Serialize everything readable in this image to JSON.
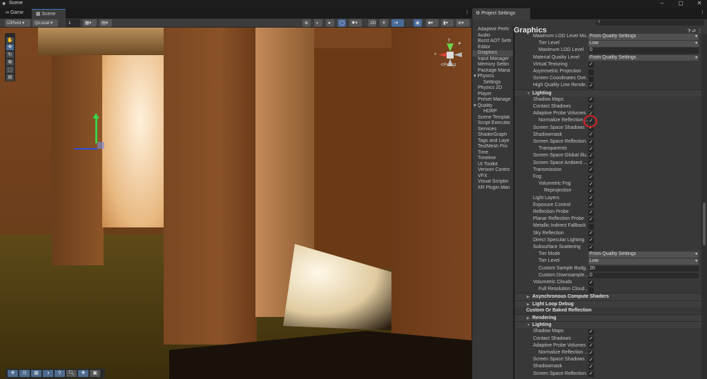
{
  "window": {
    "title": "Scene",
    "minimize": "–",
    "maximize": "▢",
    "close": "✕"
  },
  "tabs": [
    {
      "label": "Game",
      "icon": "gamepad-icon"
    },
    {
      "label": "Scene",
      "icon": "grid-icon"
    }
  ],
  "toolbar": {
    "pivot": "Pivot",
    "local": "Local",
    "grid_value": "1",
    "more": "⋮"
  },
  "scene": {
    "persp_label": "Persp",
    "gizmo_y": "y",
    "gizmo_x": "x"
  },
  "project_settings": {
    "tab_label": "Project Settings",
    "more": "⋮",
    "search_placeholder": "",
    "title": "Graphics",
    "nav": [
      "Adaptive Perfc",
      "Audio",
      "Burst AOT Setti",
      "Editor",
      "Graphics",
      "Input Manager",
      "Memory Settin",
      "Package Mana",
      "Physics",
      "Settings",
      "Physics 2D",
      "Player",
      "Preset Manage",
      "Quality",
      "HDRP",
      "Scene Templat",
      "Script Executio",
      "Services",
      "ShaderGraph",
      "Tags and Laye",
      "TextMesh Pro",
      "Time",
      "Timeline",
      "UI Toolkit",
      "Version Contro",
      "VFX",
      "Visual Scriptin",
      "XR Plugin Man"
    ],
    "selected_nav": "Graphics",
    "rows": [
      {
        "t": "dd",
        "l": "Maximum LOD Level Mo...",
        "v": "From Quality Settings",
        "i": 1
      },
      {
        "t": "dd",
        "l": "Tier Level",
        "v": "Low",
        "i": 2
      },
      {
        "t": "in",
        "l": "Maximum LOD Level",
        "v": "0",
        "i": 2
      },
      {
        "t": "dd",
        "l": "Material Quality Level",
        "v": "From Quality Settings",
        "i": 1
      },
      {
        "t": "cb",
        "l": "Virtual Texturing",
        "v": true,
        "i": 1
      },
      {
        "t": "cb",
        "l": "Asymmetric Projection",
        "v": false,
        "i": 1
      },
      {
        "t": "cb",
        "l": "Screen Coordinates Ove...",
        "v": false,
        "i": 1
      },
      {
        "t": "cb",
        "l": "High Quality Line Rende...",
        "v": true,
        "i": 1
      },
      {
        "t": "hdr",
        "l": "Lighting",
        "open": true
      },
      {
        "t": "cb",
        "l": "Shadow Maps",
        "v": true,
        "i": 1
      },
      {
        "t": "cb",
        "l": "Contact Shadows",
        "v": true,
        "i": 1
      },
      {
        "t": "cb",
        "l": "Adaptive Probe Volumes",
        "v": true,
        "i": 1
      },
      {
        "t": "cb",
        "l": "Normalize Reflection ...",
        "v": true,
        "i": 2
      },
      {
        "t": "cb",
        "l": "Screen Space Shadows",
        "v": true,
        "i": 1
      },
      {
        "t": "cb",
        "l": "Shadowmask",
        "v": true,
        "i": 1
      },
      {
        "t": "cb",
        "l": "Screen Space Reflection",
        "v": true,
        "i": 1
      },
      {
        "t": "cb",
        "l": "Transparents",
        "v": true,
        "i": 2
      },
      {
        "t": "cb",
        "l": "Screen Space Global Illu...",
        "v": true,
        "i": 1
      },
      {
        "t": "cb",
        "l": "Screen Space Ambient ...",
        "v": true,
        "i": 1
      },
      {
        "t": "cb",
        "l": "Transmission",
        "v": true,
        "i": 1
      },
      {
        "t": "cb",
        "l": "Fog",
        "v": true,
        "i": 1
      },
      {
        "t": "cb",
        "l": "Volumetric Fog",
        "v": true,
        "i": 2
      },
      {
        "t": "cb",
        "l": "Reprojection",
        "v": true,
        "i": 3
      },
      {
        "t": "cb",
        "l": "Light Layers",
        "v": true,
        "i": 1
      },
      {
        "t": "cb",
        "l": "Exposure Control",
        "v": true,
        "i": 1
      },
      {
        "t": "cb",
        "l": "Reflection Probe",
        "v": true,
        "i": 1
      },
      {
        "t": "cb",
        "l": "Planar Reflection Probe",
        "v": true,
        "i": 1
      },
      {
        "t": "cb",
        "l": "Metallic Indirect Fallback",
        "v": false,
        "i": 1
      },
      {
        "t": "cb",
        "l": "Sky Reflection",
        "v": true,
        "i": 1
      },
      {
        "t": "cb",
        "l": "Direct Specular Lighting",
        "v": true,
        "i": 1
      },
      {
        "t": "cb",
        "l": "Subsurface Scattering",
        "v": true,
        "i": 1
      },
      {
        "t": "dd",
        "l": "Tier Mode",
        "v": "From Quality Settings",
        "i": 2
      },
      {
        "t": "dd",
        "l": "Tier Level",
        "v": "Low",
        "i": 2
      },
      {
        "t": "in",
        "l": "Custom Sample Budg...",
        "v": "20",
        "i": 2
      },
      {
        "t": "in",
        "l": "Custom Downsample...",
        "v": "0",
        "i": 2
      },
      {
        "t": "cb",
        "l": "Volumetric Clouds",
        "v": true,
        "i": 1
      },
      {
        "t": "cb",
        "l": "Full Resolution Cloud...",
        "v": false,
        "i": 2
      },
      {
        "t": "hdr",
        "l": "Asynchronous Compute Shaders",
        "open": false
      },
      {
        "t": "hdr",
        "l": "Light Loop Debug",
        "open": false
      },
      {
        "t": "sec",
        "l": "Custom Or Baked Reflection"
      },
      {
        "t": "hdr",
        "l": "Rendering",
        "open": false
      },
      {
        "t": "hdr",
        "l": "Lighting",
        "open": true
      },
      {
        "t": "cb",
        "l": "Shadow Maps",
        "v": true,
        "i": 1
      },
      {
        "t": "cb",
        "l": "Contact Shadows",
        "v": true,
        "i": 1
      },
      {
        "t": "cb",
        "l": "Adaptive Probe Volumes",
        "v": true,
        "i": 1
      },
      {
        "t": "cb",
        "l": "Normalize Reflection ...",
        "v": true,
        "i": 2
      },
      {
        "t": "cb",
        "l": "Screen Space Shadows",
        "v": true,
        "i": 1
      },
      {
        "t": "cb",
        "l": "Shadowmask",
        "v": true,
        "i": 1
      },
      {
        "t": "cb",
        "l": "Screen Space Reflection",
        "v": true,
        "i": 1
      }
    ]
  },
  "colors": {
    "accent": "#3a79bb",
    "highlight": "#d8202a"
  }
}
